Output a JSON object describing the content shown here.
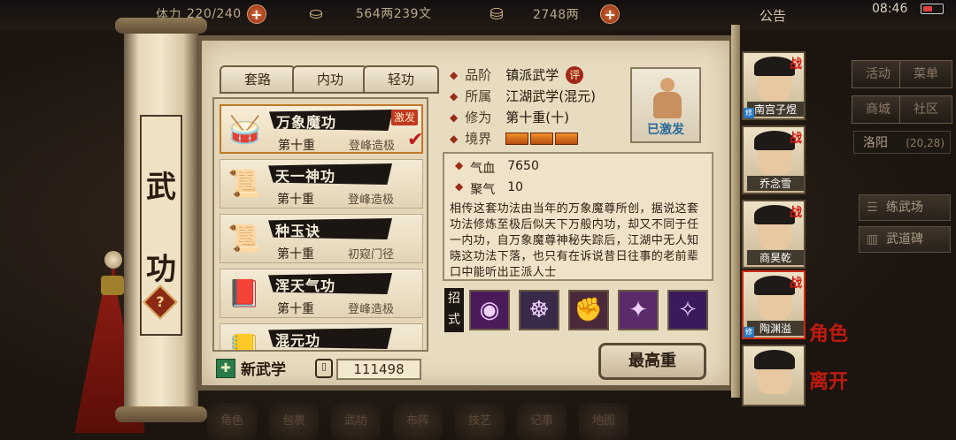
{
  "topbar": {
    "stamina_label": "体力",
    "stamina": "220/240",
    "silver": "564两239文",
    "gold": "2748两",
    "notice": "公告",
    "time": "08:46",
    "plus": "+"
  },
  "scroll": {
    "title_chars": [
      "武",
      "功"
    ],
    "help": "?"
  },
  "tabs": [
    "套路",
    "内功",
    "轻功"
  ],
  "skills": [
    {
      "icon": "drum-icon",
      "glyph": "🥁",
      "name": "万象魔功",
      "level": "第十重",
      "stage": "登峰造极",
      "badge": "激发",
      "selected": true
    },
    {
      "icon": "scroll-purple-icon",
      "glyph": "📜",
      "name": "天一神功",
      "level": "第十重",
      "stage": "登峰造极"
    },
    {
      "icon": "scroll-red-icon",
      "glyph": "📜",
      "name": "种玉诀",
      "level": "第十重",
      "stage": "初窥门径"
    },
    {
      "icon": "book-red-icon",
      "glyph": "📕",
      "name": "浑天气功",
      "level": "第十重",
      "stage": "登峰造极"
    },
    {
      "icon": "book-gold-icon",
      "glyph": "📒",
      "name": "混元功",
      "level": "",
      "stage": ""
    }
  ],
  "new_skill_label": "新武学",
  "points": "111498",
  "info": {
    "grade_key": "品阶",
    "grade_val": "镇派武学",
    "grade_eval": "评",
    "faction_key": "所属",
    "faction_val": "江湖武学(混元)",
    "cultivation_key": "修为",
    "cultivation_val": "第十重(十)",
    "realm_key": "境界",
    "realm_segments": 3
  },
  "portrait_label": "已激发",
  "stats": [
    {
      "key": "气血",
      "val": "7650"
    },
    {
      "key": "聚气",
      "val": "10"
    }
  ],
  "description": "相传这套功法由当年的万象魔尊所创，据说这套功法修炼至极后似天下万般内功，却又不同于任一内功，自万象魔尊神秘失踪后，江湖中无人知晓这功法下落，也只有在诉说昔日往事的老前辈口中能听出正派人士",
  "moves_label": "招式",
  "moves": [
    {
      "name": "move-vortex-icon",
      "glyph": "◉",
      "color": "#4a1a5a"
    },
    {
      "name": "move-monk-icon",
      "glyph": "☸",
      "color": "#3a2a4a"
    },
    {
      "name": "move-fist-icon",
      "glyph": "✊",
      "color": "#4a2a3a"
    },
    {
      "name": "move-kick-icon",
      "glyph": "✦",
      "color": "#5a2a6a"
    },
    {
      "name": "move-palm-icon",
      "glyph": "✧",
      "color": "#3a1a5a"
    }
  ],
  "max_button": "最高重",
  "characters": [
    {
      "name": "南宫子煜",
      "tag": "战"
    },
    {
      "name": "乔念雪",
      "tag": "战"
    },
    {
      "name": "商昊乾",
      "tag": "战"
    },
    {
      "name": "陶渊溢",
      "tag": "战",
      "active": true
    },
    {
      "name": "",
      "tag": ""
    }
  ],
  "side_labels": [
    "角色",
    "离开"
  ],
  "right_menu": [
    "活动",
    "菜单",
    "商城",
    "社区"
  ],
  "location": {
    "name": "洛阳",
    "count": "(20,28)"
  },
  "facilities": [
    "练武场",
    "武道碑"
  ],
  "bottom_nav": [
    "角色",
    "包裹",
    "武功",
    "布阵",
    "技艺",
    "记事",
    "地图"
  ]
}
